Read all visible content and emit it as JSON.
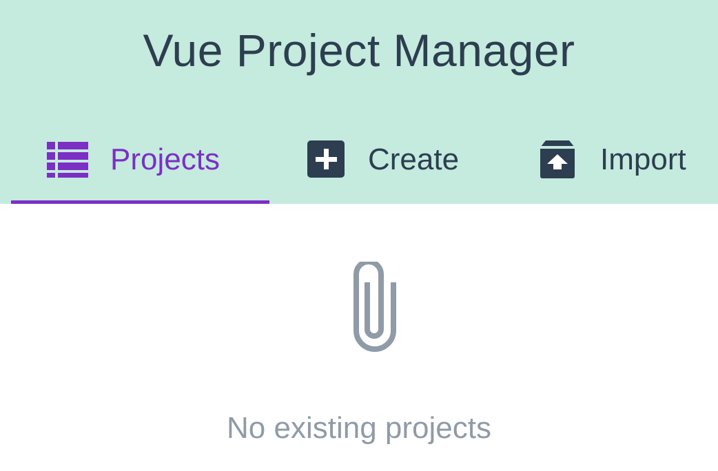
{
  "app": {
    "title": "Vue Project Manager"
  },
  "tabs": [
    {
      "label": "Projects",
      "icon": "list-icon",
      "active": true
    },
    {
      "label": "Create",
      "icon": "plus-square-icon",
      "active": false
    },
    {
      "label": "Import",
      "icon": "import-box-icon",
      "active": false
    }
  ],
  "empty_state": {
    "icon": "paperclip-icon",
    "message": "No existing projects"
  },
  "colors": {
    "header_bg": "#c5eade",
    "accent": "#7b2fc4",
    "text": "#2c3e50",
    "muted": "#8f9ba6"
  }
}
